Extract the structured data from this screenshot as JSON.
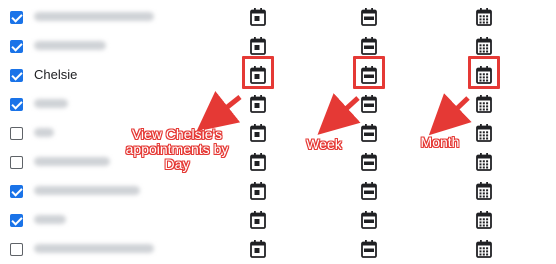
{
  "rows": [
    {
      "checked": true,
      "name": "",
      "blurred": true
    },
    {
      "checked": true,
      "name": "",
      "blurred": true
    },
    {
      "checked": true,
      "name": "Chelsie",
      "blurred": false,
      "highlighted": true
    },
    {
      "checked": true,
      "name": "",
      "blurred": true
    },
    {
      "checked": false,
      "name": "",
      "blurred": true
    },
    {
      "checked": false,
      "name": "",
      "blurred": true
    },
    {
      "checked": true,
      "name": "",
      "blurred": true
    },
    {
      "checked": true,
      "name": "",
      "blurred": true
    },
    {
      "checked": false,
      "name": "",
      "blurred": true
    }
  ],
  "columns": [
    {
      "view": "day",
      "icon": "calendar-day-icon"
    },
    {
      "view": "week",
      "icon": "calendar-week-icon"
    },
    {
      "view": "month",
      "icon": "calendar-month-icon"
    }
  ],
  "annotations": {
    "day": "View Chelsie's\nappointments by\nDay",
    "week": "Week",
    "month": "Month"
  },
  "colors": {
    "checkbox": "#1a73e8",
    "icon": "#202124",
    "annotation": "#e53935"
  }
}
